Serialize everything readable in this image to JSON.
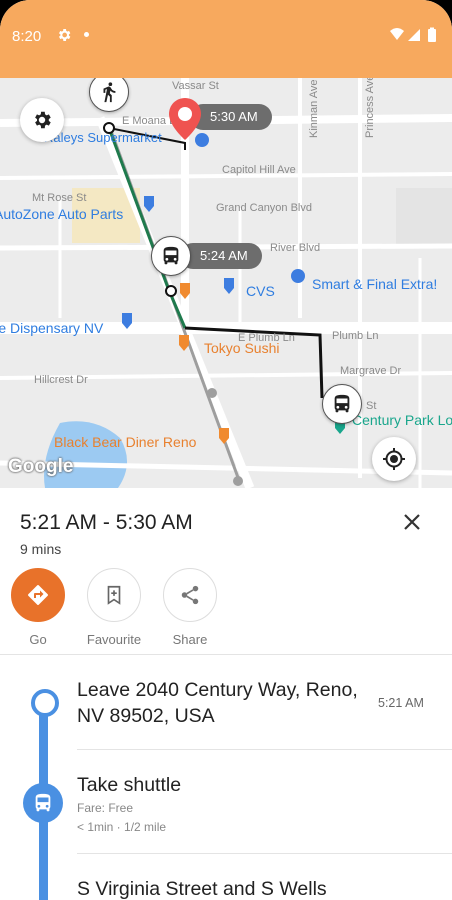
{
  "status_bar": {
    "time": "8:20"
  },
  "map": {
    "streets": [
      "Vassar St",
      "E Moana Ln",
      "Mt Rose St",
      "Capitol Hill Ave",
      "Grand Canyon Blvd",
      "River Blvd",
      "Plumb Ln",
      "E Plumb Ln",
      "Margrave Dr",
      "Hillcrest Dr",
      "Kinman Ave",
      "Princess Ave",
      "St"
    ],
    "pois_blue": [
      "Raleys Supermarket",
      "AutoZone Auto Parts",
      "CVS",
      "Smart & Final Extra!",
      "The Dispensary NV",
      "Century Park Lo"
    ],
    "pois_orange": [
      "Tokyo Sushi",
      "Black Bear Diner Reno"
    ],
    "destination_time": "5:30 AM",
    "bus_time": "5:24 AM",
    "attribution": "Google",
    "icons": [
      "settings-icon",
      "walk-icon",
      "location-pin-icon",
      "bus-icon",
      "my-location-icon"
    ]
  },
  "trip": {
    "time_range": "5:21 AM - 5:30 AM",
    "duration": "9 mins"
  },
  "actions": [
    {
      "label": "Go",
      "icon": "directions-icon"
    },
    {
      "label": "Favourite",
      "icon": "bookmark-add-icon"
    },
    {
      "label": "Share",
      "icon": "share-icon"
    }
  ],
  "steps": [
    {
      "title": "Leave 2040 Century Way, Reno, NV 89502, USA",
      "time": "5:21 AM"
    },
    {
      "title": "Take shuttle",
      "fare": "Fare: Free",
      "detail": "< 1min · 1/2 mile"
    },
    {
      "title": "S Virginia Street and S Wells"
    }
  ],
  "colors": {
    "accent": "#e8722a",
    "status_bar": "#f7a95e",
    "timeline": "#4a90e2",
    "pin": "#ef5350"
  }
}
